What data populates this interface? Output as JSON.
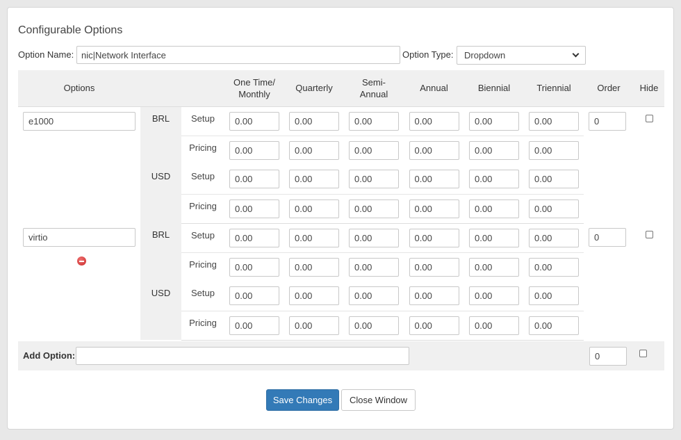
{
  "title": "Configurable Options",
  "option_name": {
    "label": "Option Name:",
    "value": "nic|Network Interface"
  },
  "option_type": {
    "label": "Option Type:",
    "value": "Dropdown"
  },
  "columns": {
    "options": "Options",
    "one_time_1": "One Time/",
    "one_time_2": "Monthly",
    "quarterly": "Quarterly",
    "semi_1": "Semi-",
    "semi_2": "Annual",
    "annual": "Annual",
    "biennial": "Biennial",
    "triennial": "Triennial",
    "order": "Order",
    "hide": "Hide"
  },
  "row_types": {
    "setup": "Setup",
    "pricing": "Pricing"
  },
  "options": [
    {
      "name": "e1000",
      "order": "0",
      "currencies": [
        {
          "code": "BRL",
          "setup": [
            "0.00",
            "0.00",
            "0.00",
            "0.00",
            "0.00",
            "0.00"
          ],
          "pricing": [
            "0.00",
            "0.00",
            "0.00",
            "0.00",
            "0.00",
            "0.00"
          ]
        },
        {
          "code": "USD",
          "setup": [
            "0.00",
            "0.00",
            "0.00",
            "0.00",
            "0.00",
            "0.00"
          ],
          "pricing": [
            "0.00",
            "0.00",
            "0.00",
            "0.00",
            "0.00",
            "0.00"
          ]
        }
      ]
    },
    {
      "name": "virtio",
      "order": "0",
      "currencies": [
        {
          "code": "BRL",
          "setup": [
            "0.00",
            "0.00",
            "0.00",
            "0.00",
            "0.00",
            "0.00"
          ],
          "pricing": [
            "0.00",
            "0.00",
            "0.00",
            "0.00",
            "0.00",
            "0.00"
          ]
        },
        {
          "code": "USD",
          "setup": [
            "0.00",
            "0.00",
            "0.00",
            "0.00",
            "0.00",
            "0.00"
          ],
          "pricing": [
            "0.00",
            "0.00",
            "0.00",
            "0.00",
            "0.00",
            "0.00"
          ]
        }
      ]
    }
  ],
  "add_option": {
    "label": "Add Option:",
    "value": "",
    "order": "0"
  },
  "buttons": {
    "save": "Save Changes",
    "close": "Close Window"
  },
  "colors": {
    "primary": "#337ab7",
    "header_bg": "#f0f0f0",
    "delete": "#c82a2a"
  }
}
